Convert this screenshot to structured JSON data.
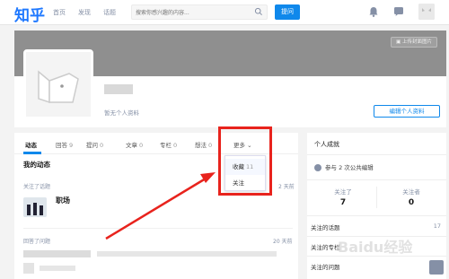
{
  "topbar": {
    "logo": "知乎",
    "nav": [
      "首页",
      "发现",
      "话题"
    ],
    "search_placeholder": "搜索你感兴趣的内容...",
    "ask_label": "提问"
  },
  "profile": {
    "upload_cover_label": "上传封面图片",
    "no_profile_text": "暂无个人资料",
    "edit_label": "编辑个人资料"
  },
  "tabs": [
    {
      "label": "动态",
      "count": ""
    },
    {
      "label": "回答",
      "count": "9"
    },
    {
      "label": "提问",
      "count": "0"
    },
    {
      "label": "文章",
      "count": "0"
    },
    {
      "label": "专栏",
      "count": "0"
    },
    {
      "label": "想法",
      "count": "0"
    },
    {
      "label": "更多",
      "count": ""
    }
  ],
  "more_menu": [
    {
      "label": "收藏",
      "count": "11"
    },
    {
      "label": "关注",
      "count": ""
    }
  ],
  "feed": {
    "title": "我的动态",
    "items": [
      {
        "action": "关注了话题",
        "time": "2 天前",
        "topic": "职场"
      },
      {
        "action": "回答了问题",
        "time": "20 天前"
      }
    ]
  },
  "sidebar": {
    "title": "个人成就",
    "achievement": "参与 2 次公共编辑",
    "following_label": "关注了",
    "following": "7",
    "followers_label": "关注者",
    "followers": "0",
    "links": [
      {
        "label": "关注的话题",
        "count": "17"
      },
      {
        "label": "关注的专栏",
        "count": ""
      },
      {
        "label": "关注的问题",
        "count": ""
      }
    ]
  },
  "watermark": "Baidu经验",
  "colors": {
    "brand": "#1e78ff",
    "primary": "#0f88eb",
    "highlight": "#e8231d"
  }
}
